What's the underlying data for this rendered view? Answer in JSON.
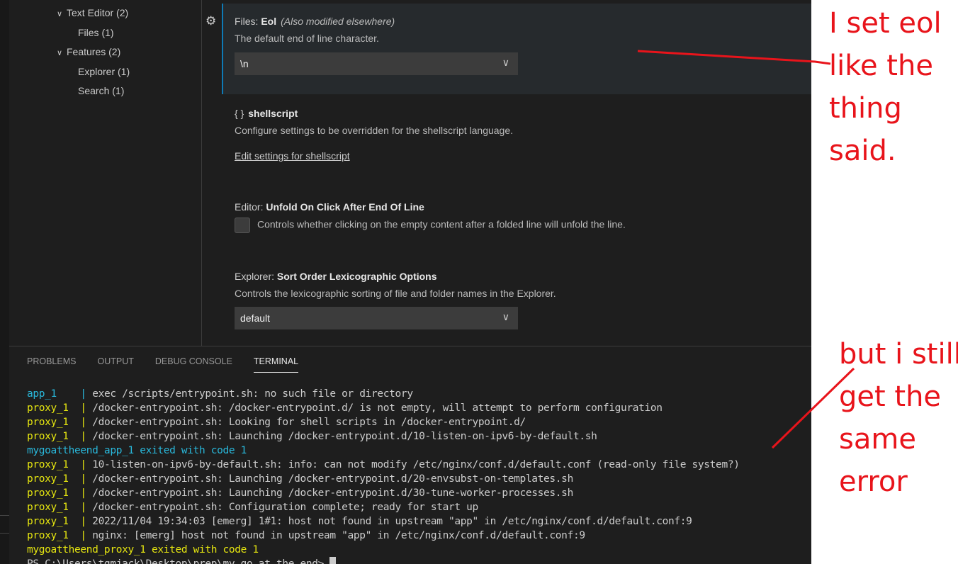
{
  "tree": [
    {
      "label": "Text Editor (2)",
      "expanded": true,
      "level": 0
    },
    {
      "label": "Files (1)",
      "level": 1
    },
    {
      "label": "Features (2)",
      "expanded": true,
      "level": 0
    },
    {
      "label": "Explorer (1)",
      "level": 1
    },
    {
      "label": "Search (1)",
      "level": 1
    }
  ],
  "settings": {
    "eol": {
      "prefix": "Files: ",
      "name": "Eol",
      "note": "(Also modified elsewhere)",
      "desc": "The default end of line character.",
      "value": "\\n"
    },
    "shellscript": {
      "icon": "{ }",
      "name": "shellscript",
      "desc": "Configure settings to be overridden for the shellscript language.",
      "link": "Edit settings for shellscript"
    },
    "unfold": {
      "prefix": "Editor: ",
      "name": "Unfold On Click After End Of Line",
      "desc": "Controls whether clicking on the empty content after a folded line will unfold the line.",
      "checked": false
    },
    "sort": {
      "prefix": "Explorer: ",
      "name": "Sort Order Lexicographic Options",
      "desc": "Controls the lexicographic sorting of file and folder names in the Explorer.",
      "value": "default"
    }
  },
  "panel": {
    "tabs": [
      "PROBLEMS",
      "OUTPUT",
      "DEBUG CONSOLE",
      "TERMINAL"
    ],
    "active": "TERMINAL"
  },
  "terminal": [
    {
      "src": "app_1    ",
      "msg": "exec /scripts/entrypoint.sh: no such file or directory"
    },
    {
      "src": "proxy_1  ",
      "msg": "/docker-entrypoint.sh: /docker-entrypoint.d/ is not empty, will attempt to perform configuration"
    },
    {
      "src": "proxy_1  ",
      "msg": "/docker-entrypoint.sh: Looking for shell scripts in /docker-entrypoint.d/"
    },
    {
      "src": "proxy_1  ",
      "msg": "/docker-entrypoint.sh: Launching /docker-entrypoint.d/10-listen-on-ipv6-by-default.sh"
    },
    {
      "plain": "mygoattheend_app_1 exited with code 1",
      "color": "app"
    },
    {
      "src": "proxy_1  ",
      "msg": "10-listen-on-ipv6-by-default.sh: info: can not modify /etc/nginx/conf.d/default.conf (read-only file system?)"
    },
    {
      "src": "proxy_1  ",
      "msg": "/docker-entrypoint.sh: Launching /docker-entrypoint.d/20-envsubst-on-templates.sh"
    },
    {
      "src": "proxy_1  ",
      "msg": "/docker-entrypoint.sh: Launching /docker-entrypoint.d/30-tune-worker-processes.sh"
    },
    {
      "src": "proxy_1  ",
      "msg": "/docker-entrypoint.sh: Configuration complete; ready for start up"
    },
    {
      "src": "proxy_1  ",
      "msg": "2022/11/04 19:34:03 [emerg] 1#1: host not found in upstream \"app\" in /etc/nginx/conf.d/default.conf:9"
    },
    {
      "src": "proxy_1  ",
      "msg": "nginx: [emerg] host not found in upstream \"app\" in /etc/nginx/conf.d/default.conf:9"
    },
    {
      "plain": "mygoattheend_proxy_1 exited with code 1",
      "color": "proxy"
    }
  ],
  "prompt": "PS C:\\Users\\tgmjack\\Desktop\\prep\\my_go_at_the_end> ",
  "annotations": {
    "top": [
      "I set eol",
      "like the",
      "thing",
      "said."
    ],
    "bottom": [
      "but i still",
      "get the",
      "same",
      "error"
    ],
    "color": "#e8141b"
  },
  "colors": {
    "app": "#29b8db",
    "proxy": "#e5e510",
    "modified_border": "#0e7ab5"
  }
}
